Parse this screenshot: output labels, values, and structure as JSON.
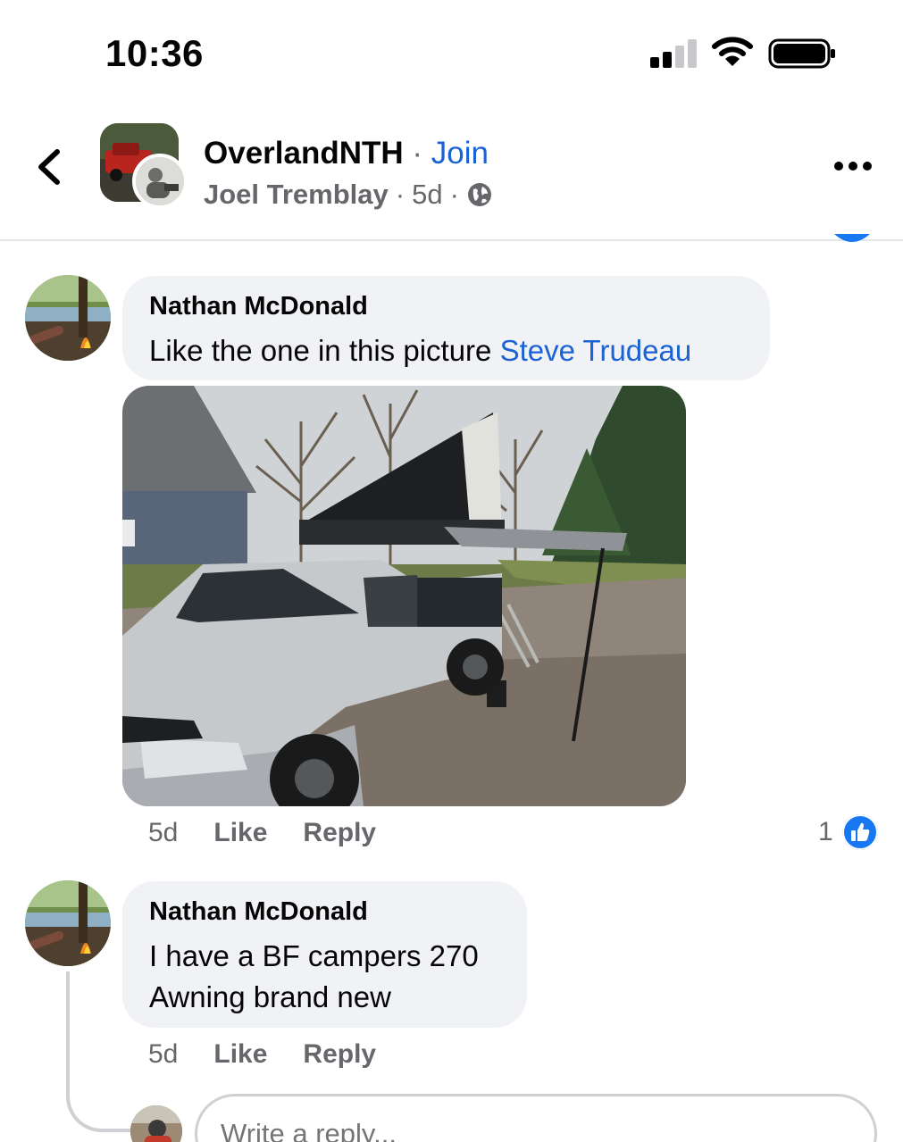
{
  "status_bar": {
    "time": "10:36"
  },
  "header": {
    "group_name": "OverlandNTH",
    "separator": " · ",
    "join_label": "Join",
    "author": "Joel Tremblay",
    "age": "5d"
  },
  "comments": [
    {
      "author": "Nathan McDonald",
      "text": "Like the one in this picture ",
      "mention": "Steve Trudeau",
      "age": "5d",
      "like_label": "Like",
      "reply_label": "Reply",
      "reaction_count": "1"
    },
    {
      "author": "Nathan McDonald",
      "text_line1": "I have a BF campers 270",
      "text_line2": "Awning brand new",
      "age": "5d",
      "like_label": "Like",
      "reply_label": "Reply"
    }
  ],
  "reply_box": {
    "placeholder": "Write a reply..."
  },
  "colors": {
    "link": "#1b63d4",
    "bubble": "#f0f2f5",
    "reaction": "#1877f2"
  }
}
